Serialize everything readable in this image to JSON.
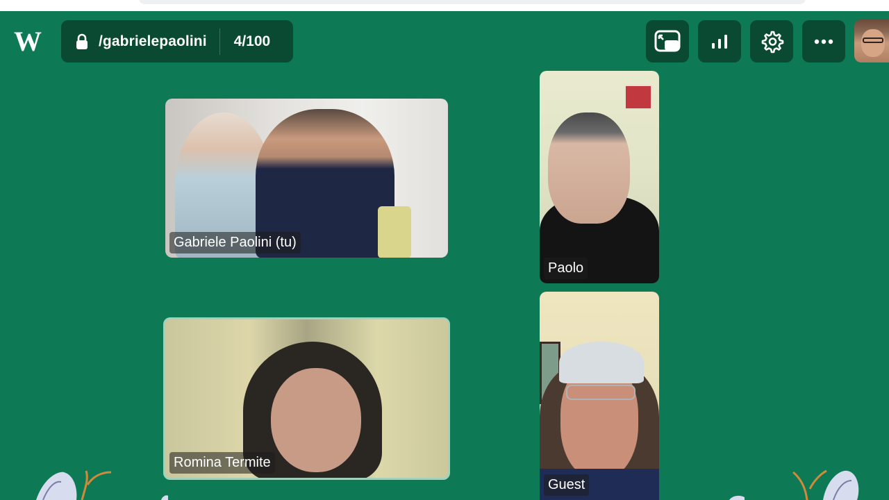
{
  "header": {
    "logo_letter": "W",
    "room_name": "/gabrielepaolini",
    "participant_count": "4/100"
  },
  "toolbar": {
    "buttons": [
      {
        "icon": "screen-share-icon"
      },
      {
        "icon": "stats-bars-icon"
      },
      {
        "icon": "gear-icon"
      },
      {
        "icon": "more-dots-icon"
      }
    ]
  },
  "participants": [
    {
      "label": "Gabriele Paolini (tu)"
    },
    {
      "label": "Paolo"
    },
    {
      "label": "Romina Termite"
    },
    {
      "label": "Guest"
    }
  ],
  "colors": {
    "background": "#0e7a55",
    "panel": "#0a4a33",
    "active_speaker_border": "#9fd3bd"
  }
}
